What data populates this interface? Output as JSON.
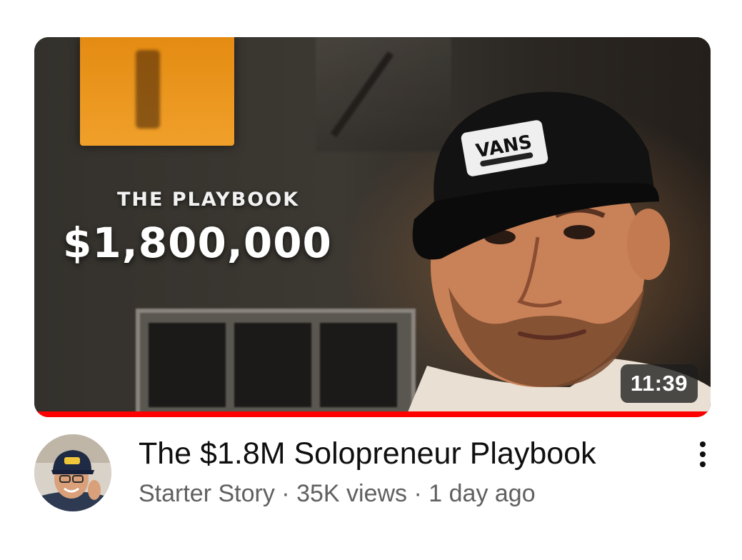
{
  "video": {
    "title": "The $1.8M Solopreneur Playbook",
    "duration": "11:39",
    "watch_progress_percent": 100,
    "thumbnail": {
      "subtitle": "THE PLAYBOOK",
      "amount": "$1,800,000",
      "cap_text": "VANS"
    }
  },
  "channel": {
    "name": "Starter Story"
  },
  "meta": {
    "views": "35K views",
    "age": "1 day ago",
    "separator": "·"
  },
  "icons": {
    "menu": "more-vertical-icon",
    "avatar": "channel-avatar"
  },
  "colors": {
    "progress": "#ff0000",
    "title_text": "#0f0f0f",
    "meta_text": "#606060",
    "duration_badge": "#1e1e1e"
  }
}
